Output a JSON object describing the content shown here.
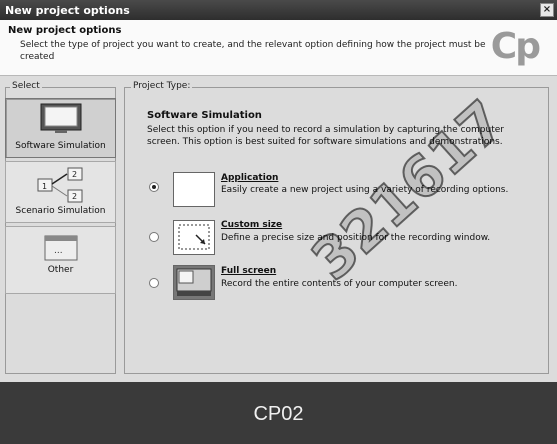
{
  "window": {
    "title": "New project options",
    "close_label": "×"
  },
  "header": {
    "title": "New project options",
    "description": "Select the type of project you want to create, and the relevant option defining how the project must be created",
    "logo_text": "Cp"
  },
  "select_group": {
    "legend": "Select",
    "items": [
      {
        "label": "Software Simulation",
        "selected": true,
        "icon": "monitor-icon"
      },
      {
        "label": "Scenario Simulation",
        "selected": false,
        "icon": "branch-steps-icon"
      },
      {
        "label": "Other",
        "selected": false,
        "icon": "window-dots-icon"
      }
    ]
  },
  "project_type": {
    "legend": "Project Type:",
    "title": "Software Simulation",
    "description": "Select this option if you need to record a simulation by capturing the computer screen. This option is best suited for software simulations and demonstrations.",
    "options": [
      {
        "title": "Application",
        "desc": "Easily create a new project using a variety of recording options.",
        "checked": true,
        "icon": "blank-window-icon"
      },
      {
        "title": "Custom size",
        "desc": "Define a precise size and position for the recording window.",
        "checked": false,
        "icon": "resize-arrow-icon"
      },
      {
        "title": "Full screen",
        "desc": "Record the entire contents of your computer screen.",
        "checked": false,
        "icon": "fullscreen-icon"
      }
    ]
  },
  "footer": {
    "caption": "CP02"
  },
  "watermark": {
    "text": "321617"
  },
  "colors": {
    "titlebar": "#2e2e2e",
    "dialog_bg": "#dcdcdc",
    "footer_bg": "#3a3a3a"
  }
}
